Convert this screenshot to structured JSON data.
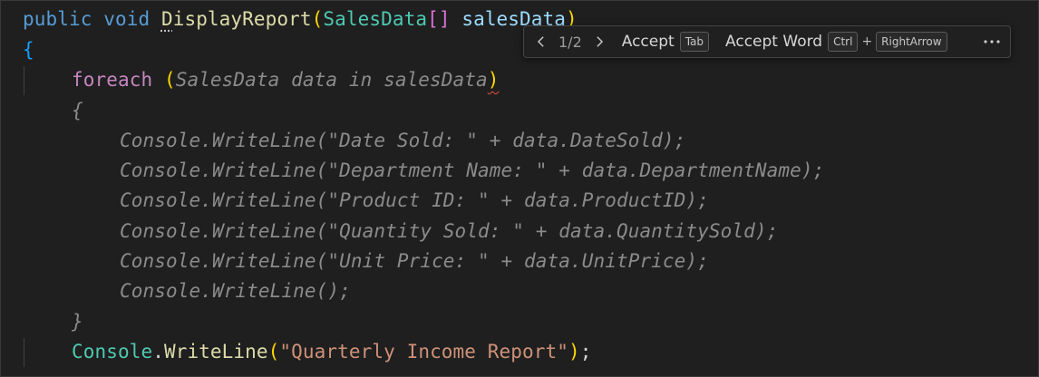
{
  "code": {
    "line1": {
      "kw1": "public",
      "kw2": "void",
      "fn_first": "D",
      "fn_rest": "isplayReport",
      "paren_open": "(",
      "type": "SalesData",
      "brackets": "[]",
      "param": "salesData",
      "paren_close": ")"
    },
    "line2": {
      "brace": "{"
    },
    "line3": {
      "kw": "foreach",
      "paren_open": "(",
      "ghost": "SalesData data in salesData",
      "paren_close": ")"
    },
    "ghost_lines": [
      "{",
      "Console.WriteLine(\"Date Sold: \" + data.DateSold);",
      "Console.WriteLine(\"Department Name: \" + data.DepartmentName);",
      "Console.WriteLine(\"Product ID: \" + data.ProductID);",
      "Console.WriteLine(\"Quantity Sold: \" + data.QuantitySold);",
      "Console.WriteLine(\"Unit Price: \" + data.UnitPrice);",
      "Console.WriteLine();",
      "}"
    ],
    "last_line": {
      "type": "Console",
      "dot": ".",
      "fn": "WriteLine",
      "paren_open": "(",
      "str": "\"Quarterly Income Report\"",
      "paren_close": ")",
      "semi": ";"
    }
  },
  "toolbar": {
    "counter": "1/2",
    "accept_label": "Accept",
    "accept_key": "Tab",
    "accept_word_label": "Accept Word",
    "accept_word_key1": "Ctrl",
    "plus": "+",
    "accept_word_key2": "RightArrow",
    "prev_icon": "chevron-left-icon",
    "next_icon": "chevron-right-icon",
    "more_icon": "ellipsis-icon"
  },
  "colors": {
    "background": "#1f1f1f",
    "keyword": "#569cd6",
    "function": "#dcdcaa",
    "type": "#4ec9b0",
    "ghost_text": "#8b8b8b",
    "string": "#ce9178"
  }
}
